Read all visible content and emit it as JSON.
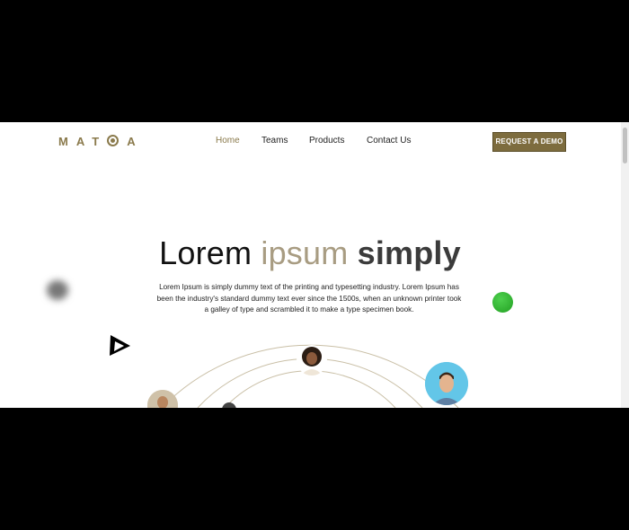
{
  "logo": {
    "text_left": "MAT",
    "text_right": "A"
  },
  "nav": {
    "items": [
      {
        "label": "Home",
        "active": true
      },
      {
        "label": "Teams",
        "active": false
      },
      {
        "label": "Products",
        "active": false
      },
      {
        "label": "Contact Us",
        "active": false
      }
    ],
    "cta_label": "REQUEST A DEMO"
  },
  "hero": {
    "title_word1": "Lorem",
    "title_word2": "ipsum",
    "title_word3": "simply",
    "description": "Lorem Ipsum is simply dummy text of the printing and typesetting industry. Lorem Ipsum has been the industry's standard dummy text ever since the 1500s, when an unknown printer took a galley of type and scrambled it to make a type specimen book."
  },
  "colors": {
    "accent": "#8a7a4c",
    "cta_bg": "#7d6c3e",
    "green_dot": "#33b833"
  },
  "decor": {
    "triangle": "play-triangle-icon",
    "blob": "blurred-circle",
    "dot": "green-circle"
  }
}
